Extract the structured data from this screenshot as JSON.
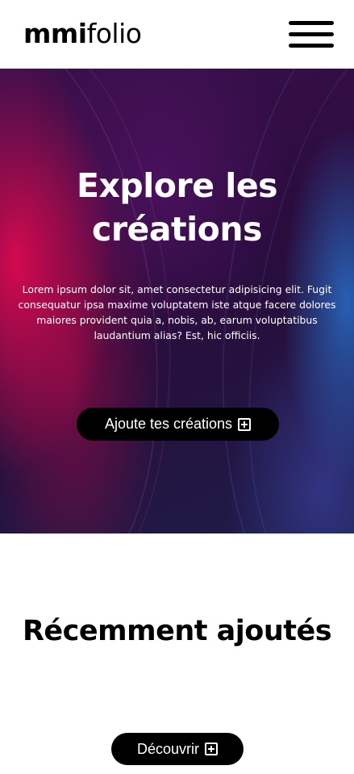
{
  "header": {
    "logo_bold": "mmi",
    "logo_light": "folio",
    "menu_icon": "hamburger-menu-icon"
  },
  "hero": {
    "title_line1": "Explore les",
    "title_line2": "créations",
    "description": "Lorem ipsum dolor sit, amet consectetur adipisicing elit. Fugit consequatur ipsa maxime voluptatem iste atque facere dolores maiores provident quia a, nobis, ab, earum voluptatibus laudantium alias? Est, hic officiis.",
    "button_label": "Ajoute tes créations",
    "button_icon": "plus-square-icon"
  },
  "recent": {
    "title": "Récemment ajoutés",
    "button_label": "Découvrir",
    "button_icon": "plus-square-icon"
  },
  "colors": {
    "text": "#000000",
    "hero_text": "#ffffff",
    "button_bg": "#000000",
    "accent_pink": "#dc0a50",
    "accent_blue": "#286ec8",
    "hero_dark": "#2a0c3d"
  }
}
